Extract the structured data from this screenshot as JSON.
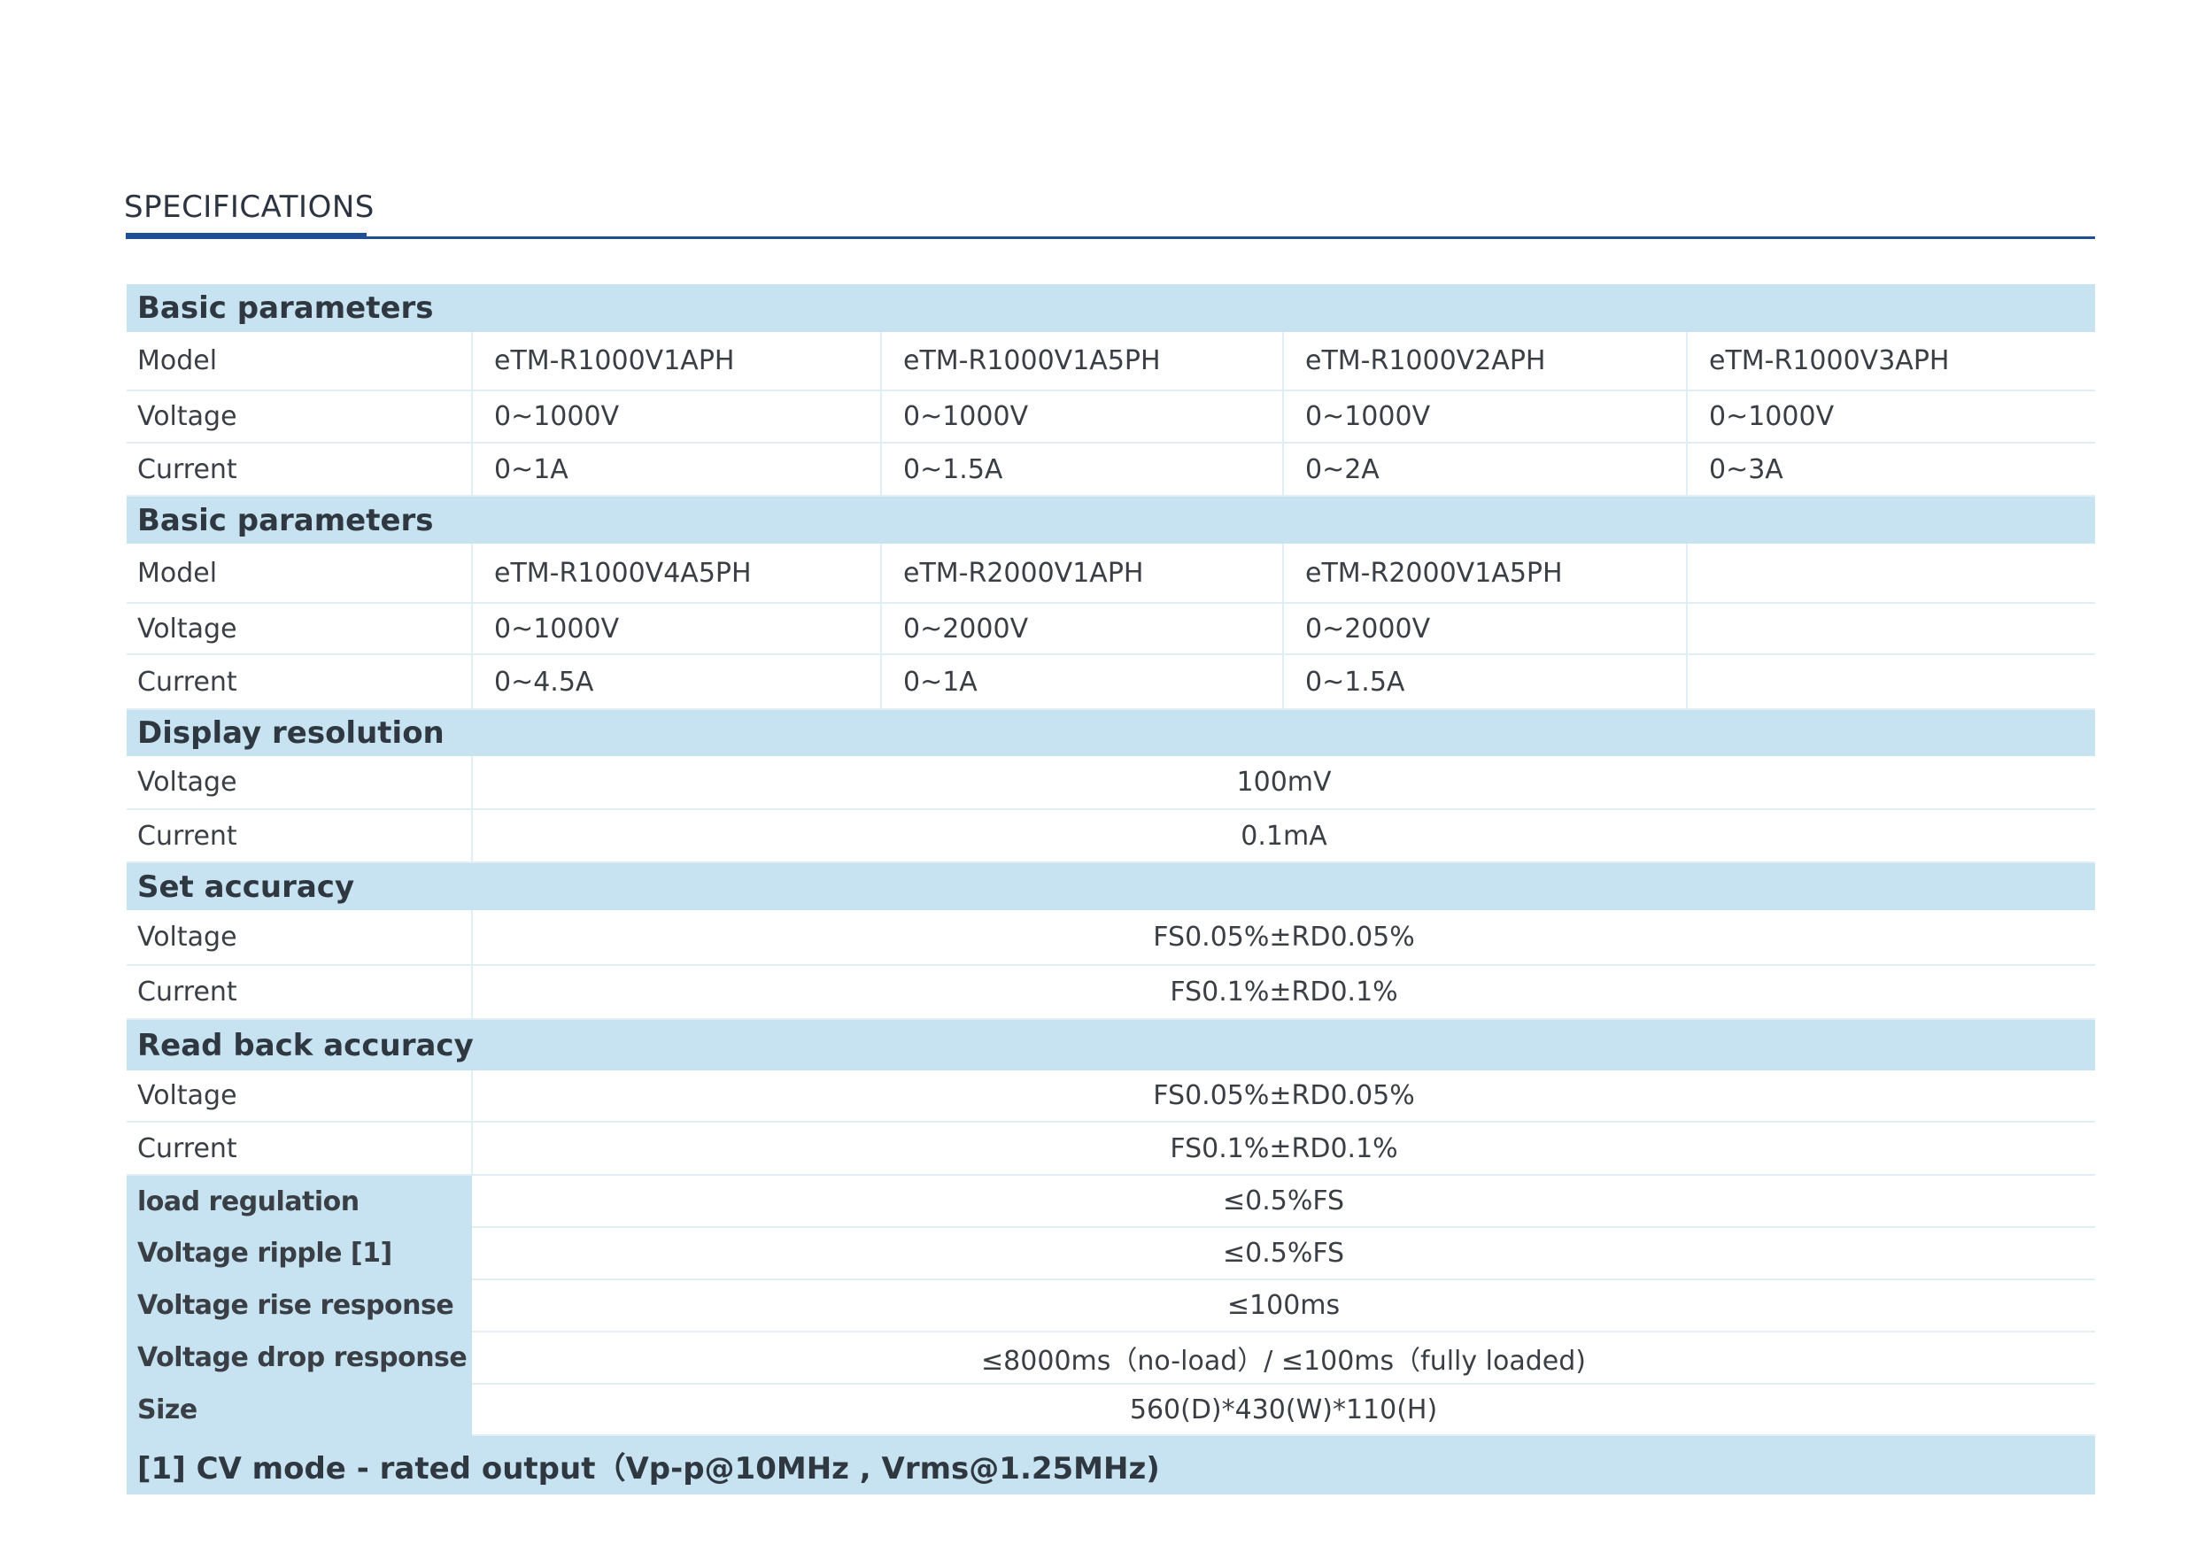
{
  "title": "SPECIFICATIONS",
  "sections": {
    "basic1": {
      "header": "Basic parameters",
      "model": [
        "Model",
        "eTM-R1000V1APH",
        "eTM-R1000V1A5PH",
        "eTM-R1000V2APH",
        "eTM-R1000V3APH"
      ],
      "voltage": [
        "Voltage",
        "0~1000V",
        "0~1000V",
        "0~1000V",
        "0~1000V"
      ],
      "current": [
        "Current",
        "0~1A",
        "0~1.5A",
        "0~2A",
        "0~3A"
      ]
    },
    "basic2": {
      "header": "Basic parameters",
      "model": [
        "Model",
        "eTM-R1000V4A5PH",
        "eTM-R2000V1APH",
        "eTM-R2000V1A5PH",
        ""
      ],
      "voltage": [
        "Voltage",
        "0~1000V",
        "0~2000V",
        "0~2000V",
        ""
      ],
      "current": [
        "Current",
        "0~4.5A",
        "0~1A",
        "0~1.5A",
        ""
      ]
    },
    "display_resolution": {
      "header": "Display resolution",
      "voltage_label": "Voltage",
      "voltage_value": "100mV",
      "current_label": "Current",
      "current_value": "0.1mA"
    },
    "set_accuracy": {
      "header": "Set accuracy",
      "voltage_label": "Voltage",
      "voltage_value": "FS0.05%±RD0.05%",
      "current_label": "Current",
      "current_value": "FS0.1%±RD0.1%"
    },
    "read_back_accuracy": {
      "header": "Read back accuracy",
      "voltage_label": "Voltage",
      "voltage_value": "FS0.05%±RD0.05%",
      "current_label": "Current",
      "current_value": "FS0.1%±RD0.1%"
    }
  },
  "single_rows": [
    {
      "label": "load regulation",
      "value": "≤0.5%FS"
    },
    {
      "label": "Voltage ripple [1]",
      "value": "≤0.5%FS"
    },
    {
      "label": "Voltage rise response",
      "value": "≤100ms"
    },
    {
      "label": "Voltage drop response",
      "value": "≤8000ms（no-load）/ ≤100ms（fully loaded)"
    },
    {
      "label": "Size",
      "value": "560(D)*430(W)*110(H)"
    }
  ],
  "footnote": "[1] CV mode - rated output（Vp-p@10MHz , Vrms@1.25MHz)",
  "colors": {
    "accent": "#1f4f95",
    "section_bg": "#c7e3f1",
    "grid": "#e2eef5",
    "text": "#3a3f45"
  }
}
